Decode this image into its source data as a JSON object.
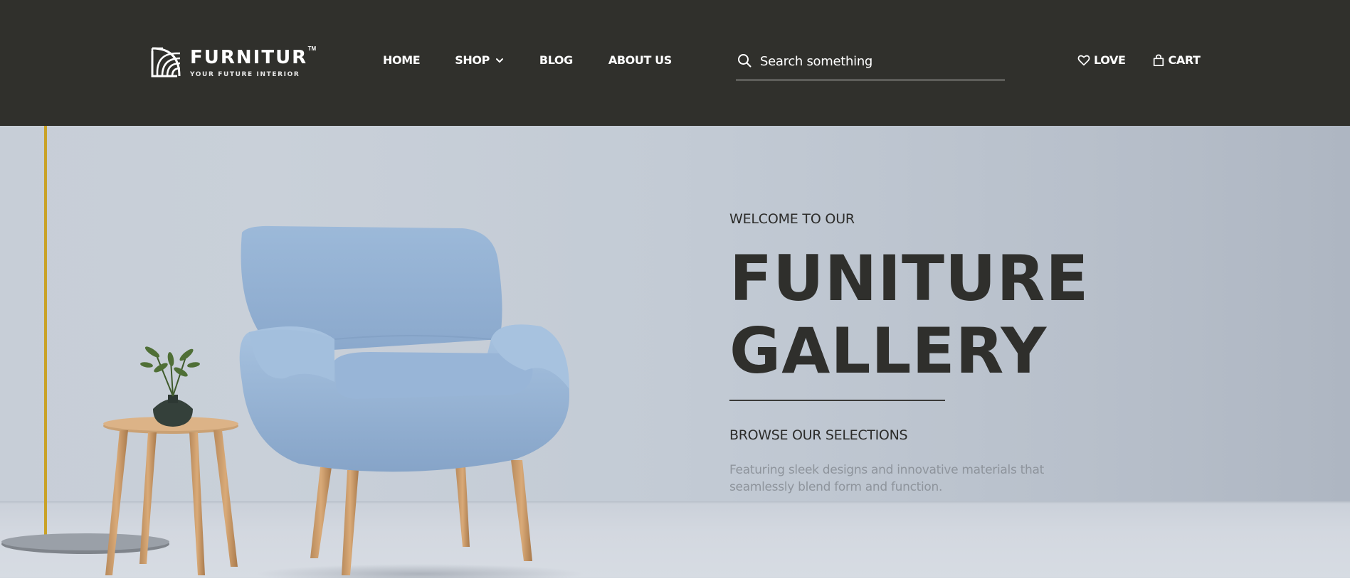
{
  "header": {
    "logo": {
      "name": "FURNITUR",
      "trademark": "TM",
      "tagline": "YOUR FUTURE INTERIOR"
    },
    "nav": {
      "home": "HOME",
      "shop": "SHOP",
      "blog": "BLOG",
      "about": "ABOUT US"
    },
    "search": {
      "placeholder": "Search something"
    },
    "actions": {
      "love": "LOVE",
      "cart": "CART"
    },
    "colors": {
      "background": "#30302c",
      "text": "#ffffff"
    }
  },
  "hero": {
    "eyebrow": "WELCOME TO OUR",
    "headline_line1": "FUNITURE",
    "headline_line2": "GALLERY",
    "subheading": "BROWSE OUR SELECTIONS",
    "description": "Featuring sleek designs and innovative materials that seamlessly blend form and function.",
    "image": "blue-armchair-with-side-table-and-plant",
    "colors": {
      "headline": "#2f2f2c",
      "description": "#8e949c",
      "background": "#c5ccd6"
    }
  },
  "icons": {
    "logo": "logo-mark-icon",
    "shop_dropdown": "chevron-down-icon",
    "search": "search-icon",
    "love": "heart-icon",
    "cart": "shopping-bag-icon"
  }
}
